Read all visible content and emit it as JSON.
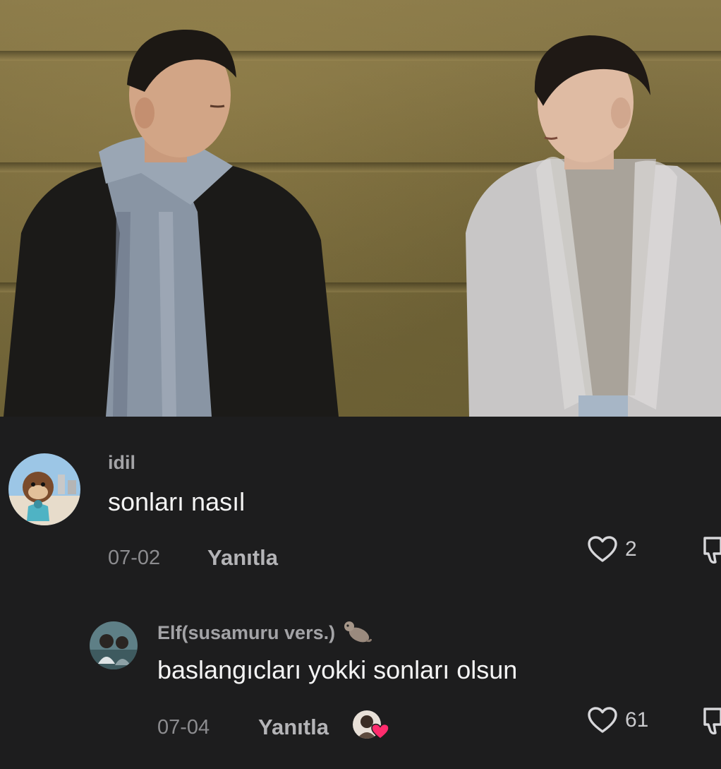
{
  "hero": {
    "image_icon": "photo-still-two-people"
  },
  "comments": [
    {
      "username": "idil",
      "text": "sonları nasıl",
      "date": "07-02",
      "reply_label": "Yanıtla",
      "likes": "2",
      "avatar_icon": "avatar-monkey-beach",
      "like_icon": "heart-outline-icon",
      "dislike_icon": "thumbs-down-icon"
    },
    {
      "username": "Elf(susamuru vers.)",
      "text": "baslangıcları yokki sonları olsun",
      "date": "07-04",
      "reply_label": "Yanıtla",
      "likes": "61",
      "avatar_icon": "avatar-couple-photo",
      "badge_icon": "otter-emoji-icon",
      "liked_by_creator_icon": "creator-avatar-heart-icon",
      "like_icon": "heart-outline-icon",
      "dislike_icon": "thumbs-down-icon"
    }
  ],
  "colors": {
    "background": "#1d1d1e",
    "username": "#a3a3a6",
    "text": "#f4f4f4",
    "meta": "#8c8c8f",
    "heart_badge": "#ff2c6d"
  }
}
